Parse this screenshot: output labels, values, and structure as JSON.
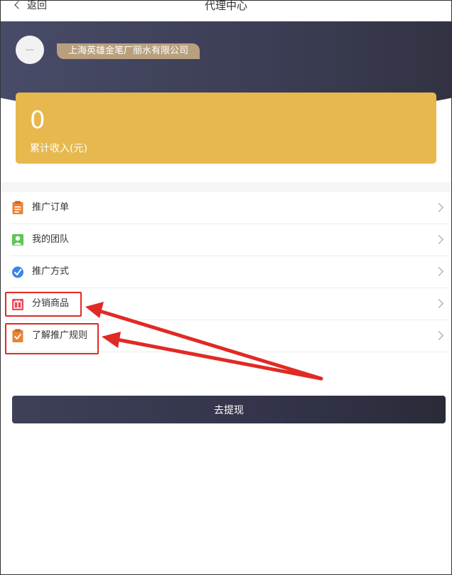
{
  "nav": {
    "back_label": "返回",
    "title": "代理中心"
  },
  "header": {
    "company_name": "上海英雄金笔厂丽水有限公司"
  },
  "income": {
    "value": "0",
    "label": "累计收入(元)",
    "color": "#e6b84e"
  },
  "menu": {
    "items": [
      {
        "label": "推广订单",
        "icon": "clipboard-icon",
        "color": "#e8833a"
      },
      {
        "label": "我的团队",
        "icon": "team-icon",
        "color": "#5ec65a"
      },
      {
        "label": "推广方式",
        "icon": "compass-icon",
        "color": "#3a86e8"
      },
      {
        "label": "分销商品",
        "icon": "gift-icon",
        "color": "#e84a5a"
      },
      {
        "label": "了解推广规则",
        "icon": "checklist-icon",
        "color": "#e8833a"
      }
    ]
  },
  "withdraw": {
    "label": "去提现"
  },
  "annotation": {
    "color": "#e02a24"
  }
}
